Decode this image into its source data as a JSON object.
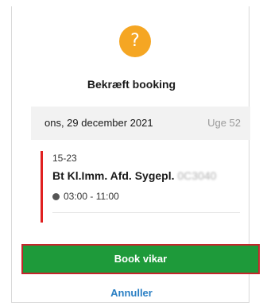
{
  "dialog": {
    "title": "Bekræft booking",
    "icon_glyph": "?",
    "icon": "help-icon",
    "accent_color": "#f5a623"
  },
  "card": {
    "date": "ons, 29 december 2021",
    "week": "Uge 52",
    "shift": {
      "code": "15-23",
      "name": "Bt Kl.Imm. Afd. Sygepl.",
      "name_blurred": "0C3040",
      "time": "03:00 - 11:00",
      "time_icon": "clock-icon",
      "status_color": "#e02020"
    }
  },
  "actions": {
    "book_label": "Book vikar",
    "book_color": "#1e9a3a",
    "cancel_label": "Annuller",
    "cancel_color": "#2a7fc4"
  }
}
